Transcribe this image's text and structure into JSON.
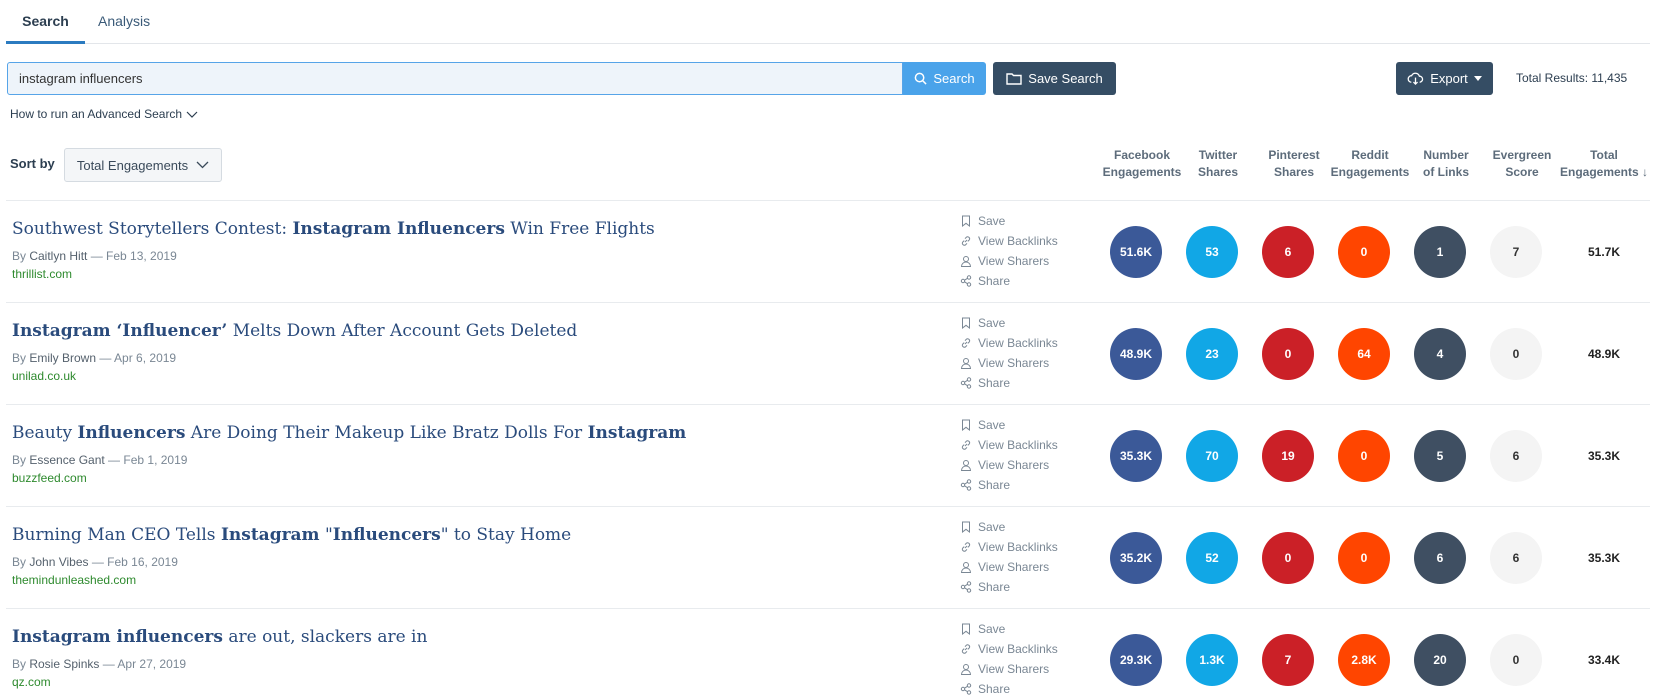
{
  "tabs": {
    "search": "Search",
    "analysis": "Analysis"
  },
  "search": {
    "value": "instagram influencers",
    "button": "Search",
    "save_button": "Save Search"
  },
  "export_button": "Export",
  "total_results": "Total Results: 11,435",
  "advanced_link": "How to run an Advanced Search",
  "sort": {
    "label": "Sort by",
    "selected": "Total Engagements"
  },
  "columns": {
    "facebook": [
      "Facebook",
      "Engagements"
    ],
    "twitter": [
      "Twitter",
      "Shares"
    ],
    "pinterest": [
      "Pinterest",
      "Shares"
    ],
    "reddit": [
      "Reddit",
      "Engagements"
    ],
    "links": [
      "Number",
      "of Links"
    ],
    "evergreen": [
      "Evergreen",
      "Score"
    ],
    "total": [
      "Total",
      "Engagements ↓"
    ]
  },
  "action_labels": {
    "save": "Save",
    "backlinks": "View Backlinks",
    "sharers": "View Sharers",
    "share": "Share"
  },
  "colors": {
    "facebook": "#3b5998",
    "twitter": "#11a7e6",
    "pinterest": "#cb2027",
    "reddit": "#ff4500",
    "links": "#3f4f62",
    "evergreen": "#f4f4f4",
    "accent": "#2b7bc0"
  },
  "results": [
    {
      "title": [
        {
          "text": "Southwest Storytellers Contest: ",
          "bold": false
        },
        {
          "text": "Instagram Influencers",
          "bold": true
        },
        {
          "text": " Win Free Flights",
          "bold": false
        }
      ],
      "author": "Caitlyn Hitt",
      "date": "Feb 13, 2019",
      "domain": "thrillist.com",
      "facebook": "51.6K",
      "twitter": "53",
      "pinterest": "6",
      "reddit": "0",
      "links": "1",
      "evergreen": "7",
      "total": "51.7K"
    },
    {
      "title": [
        {
          "text": "Instagram ‘Influencer’",
          "bold": true
        },
        {
          "text": " Melts Down After Account Gets Deleted",
          "bold": false
        }
      ],
      "author": "Emily Brown",
      "date": "Apr 6, 2019",
      "domain": "unilad.co.uk",
      "facebook": "48.9K",
      "twitter": "23",
      "pinterest": "0",
      "reddit": "64",
      "links": "4",
      "evergreen": "0",
      "total": "48.9K"
    },
    {
      "title": [
        {
          "text": "Beauty ",
          "bold": false
        },
        {
          "text": "Influencers",
          "bold": true
        },
        {
          "text": " Are Doing Their Makeup Like Bratz Dolls For ",
          "bold": false
        },
        {
          "text": "Instagram",
          "bold": true
        }
      ],
      "author": "Essence Gant",
      "date": "Feb 1, 2019",
      "domain": "buzzfeed.com",
      "facebook": "35.3K",
      "twitter": "70",
      "pinterest": "19",
      "reddit": "0",
      "links": "5",
      "evergreen": "6",
      "total": "35.3K"
    },
    {
      "title": [
        {
          "text": "Burning Man CEO Tells ",
          "bold": false
        },
        {
          "text": "Instagram",
          "bold": true
        },
        {
          "text": " \"",
          "bold": false
        },
        {
          "text": "Influencers",
          "bold": true
        },
        {
          "text": "\" to Stay Home",
          "bold": false
        }
      ],
      "author": "John Vibes",
      "date": "Feb 16, 2019",
      "domain": "themindunleashed.com",
      "facebook": "35.2K",
      "twitter": "52",
      "pinterest": "0",
      "reddit": "0",
      "links": "6",
      "evergreen": "6",
      "total": "35.3K"
    },
    {
      "title": [
        {
          "text": "Instagram influencers",
          "bold": true
        },
        {
          "text": " are out, slackers are in",
          "bold": false
        }
      ],
      "author": "Rosie Spinks",
      "date": "Apr 27, 2019",
      "domain": "qz.com",
      "facebook": "29.3K",
      "twitter": "1.3K",
      "pinterest": "7",
      "reddit": "2.8K",
      "links": "20",
      "evergreen": "0",
      "total": "33.4K"
    }
  ]
}
